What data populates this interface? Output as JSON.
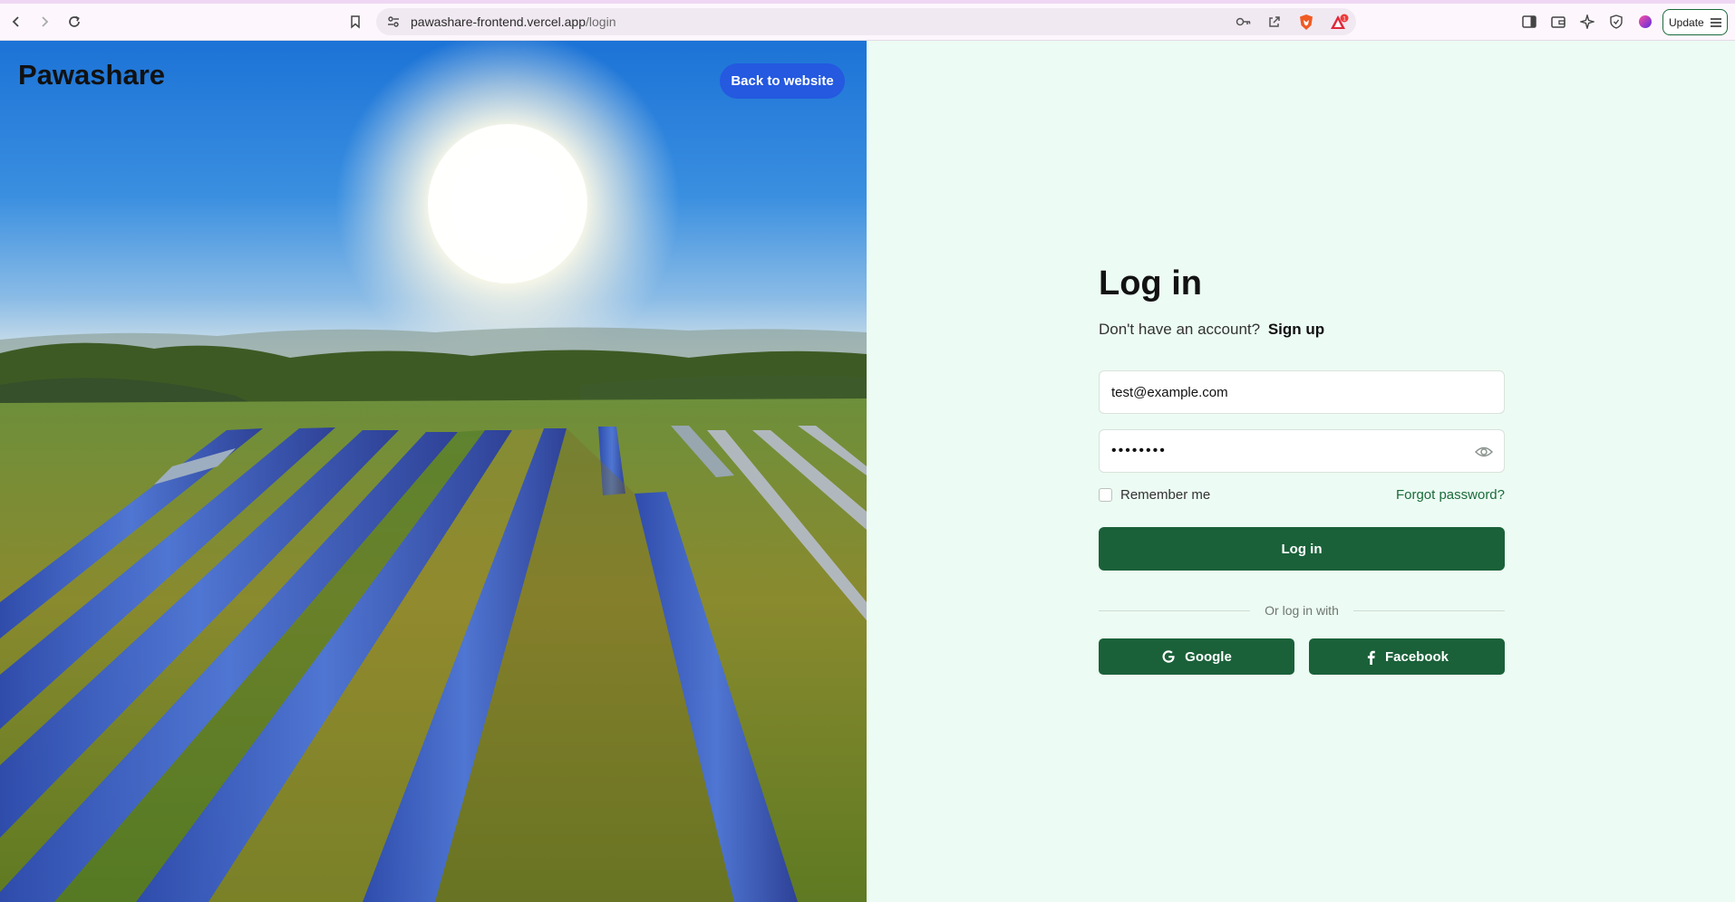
{
  "browser": {
    "url_host": "pawashare-frontend.vercel.app",
    "url_path": "/login",
    "update_label": "Update",
    "notification_count": "1"
  },
  "hero": {
    "brand": "Pawashare",
    "back_label": "Back to website"
  },
  "login": {
    "title": "Log in",
    "signup_prompt": "Don't have an account?",
    "signup_link": "Sign up",
    "email_value": "test@example.com",
    "password_mask": "••••••••",
    "remember_label": "Remember me",
    "forgot_label": "Forgot password?",
    "submit_label": "Log in",
    "divider_label": "Or log in with",
    "google_label": "Google",
    "facebook_label": "Facebook"
  },
  "colors": {
    "brand_green": "#1a6139",
    "back_button_blue": "#2459e0",
    "page_background": "#ecfbf3"
  }
}
